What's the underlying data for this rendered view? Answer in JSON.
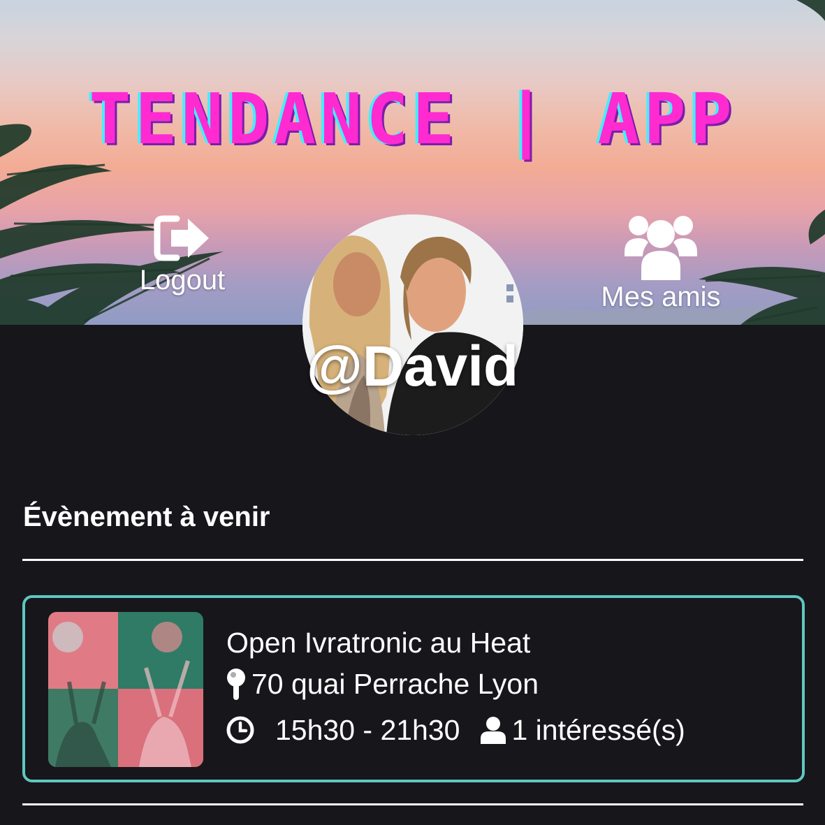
{
  "header": {
    "app_title": "TENDANCE | APP",
    "logout_label": "Logout",
    "friends_label": "Mes amis"
  },
  "profile": {
    "username": "@David"
  },
  "events_section": {
    "title": "Évènement à venir",
    "events": [
      {
        "title": "Open Ivratronic au Heat",
        "address": "70 quai Perrache Lyon",
        "time": "15h30 - 21h30",
        "interested": "1 intéressé(s)"
      }
    ]
  },
  "colors": {
    "background": "#17161b",
    "card_border": "#5fc7c1",
    "title_pink": "#ff2bd1",
    "title_cyan": "#3ff1ff"
  },
  "icons": {
    "logout": "sign-out-icon",
    "friends": "users-icon",
    "location": "map-pin-icon",
    "time": "clock-icon",
    "interested": "user-icon"
  }
}
